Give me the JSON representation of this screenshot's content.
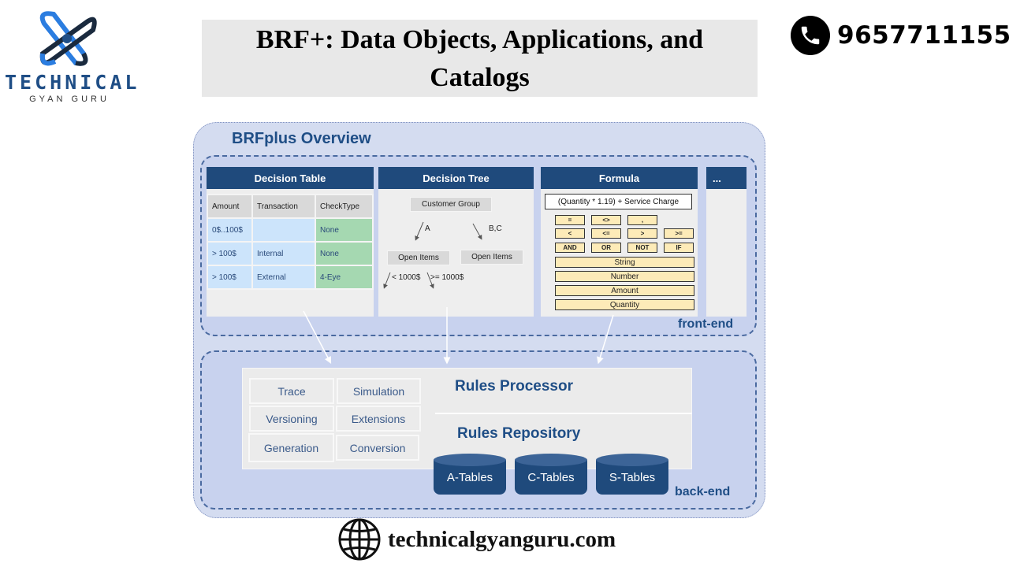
{
  "logo": {
    "icon": "atom-orbit-logo-icon",
    "wordmark": "TECHNICAL",
    "subtitle": "GYAN GURU"
  },
  "header": {
    "title_line1": "BRF+: Data Objects, Applications, and",
    "title_line2": "Catalogs",
    "phone": {
      "icon": "phone-icon",
      "number": "9657711155"
    }
  },
  "diagram": {
    "title": "BRFplus Overview",
    "frontend_label": "front-end",
    "backend_label": "back-end",
    "decision_table": {
      "title": "Decision Table",
      "columns": [
        "Amount",
        "Transaction",
        "CheckType"
      ],
      "rows": [
        [
          "0$..100$",
          "",
          "None"
        ],
        [
          "> 100$",
          "Internal",
          "None"
        ],
        [
          "> 100$",
          "External",
          "4-Eye"
        ]
      ]
    },
    "decision_tree": {
      "title": "Decision Tree",
      "root": "Customer Group",
      "branch_left": "A",
      "branch_right": "B,C",
      "node_left": "Open Items",
      "node_right": "Open Items",
      "sub_left": "< 1000$",
      "sub_right": ">= 1000$"
    },
    "formula": {
      "title": "Formula",
      "expression": "(Quantity * 1.19) + Service Charge",
      "operator_rows": [
        [
          "=",
          "<>",
          ","
        ],
        [
          "<",
          "<=",
          ">",
          ">="
        ],
        [
          "AND",
          "OR",
          "NOT",
          "IF"
        ]
      ],
      "types": [
        "String",
        "Number",
        "Amount",
        "Quantity"
      ]
    },
    "more_panel": {
      "title": "..."
    },
    "services": [
      "Trace",
      "Simulation",
      "Versioning",
      "Extensions",
      "Generation",
      "Conversion"
    ],
    "rules_processor": "Rules Processor",
    "rules_repository": "Rules Repository",
    "tables": [
      "A-Tables",
      "C-Tables",
      "S-Tables"
    ],
    "colors": {
      "header_blue": "#1f4a7c",
      "zone_blue": "#c8d2ee",
      "text_blue": "#1f4e86",
      "green_cell": "#a5d8b1",
      "blue_cell": "#cce4fb",
      "key_yellow": "#fdebb8"
    }
  },
  "footer": {
    "icon": "globe-icon",
    "url": "technicalgyanguru.com"
  }
}
